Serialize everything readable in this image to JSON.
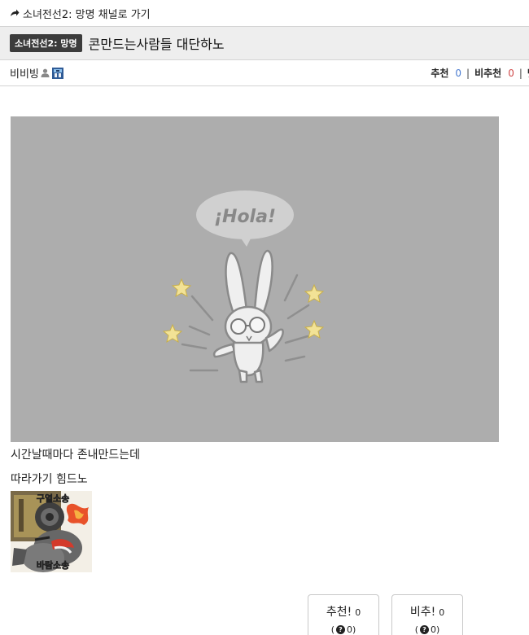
{
  "nav": {
    "back_link": "소녀전선2: 망명 채널로 가기"
  },
  "post": {
    "channel_badge": "소녀전선2: 망명",
    "title": "콘만드는사람들 대단하노",
    "author": "비비빙",
    "stats": {
      "recommend_label": "추천",
      "recommend_count": "0",
      "notrecommend_label": "비추천",
      "notrecommend_count": "0",
      "comments_label": "댓글"
    },
    "image_placeholder_text": "¡Hola!",
    "body_line1": "시간날때마다 존내만드는데",
    "body_line2": "따라가기 힘드노",
    "sticker_top_text": "구열소송",
    "sticker_bottom_text": "바람소송"
  },
  "votes": {
    "up_label": "추천!",
    "up_count": "0",
    "up_sub_open": "(",
    "up_sub_count": "0)",
    "down_label": "비추!",
    "down_count": "0",
    "down_sub_open": "(",
    "down_sub_count": "0)"
  }
}
